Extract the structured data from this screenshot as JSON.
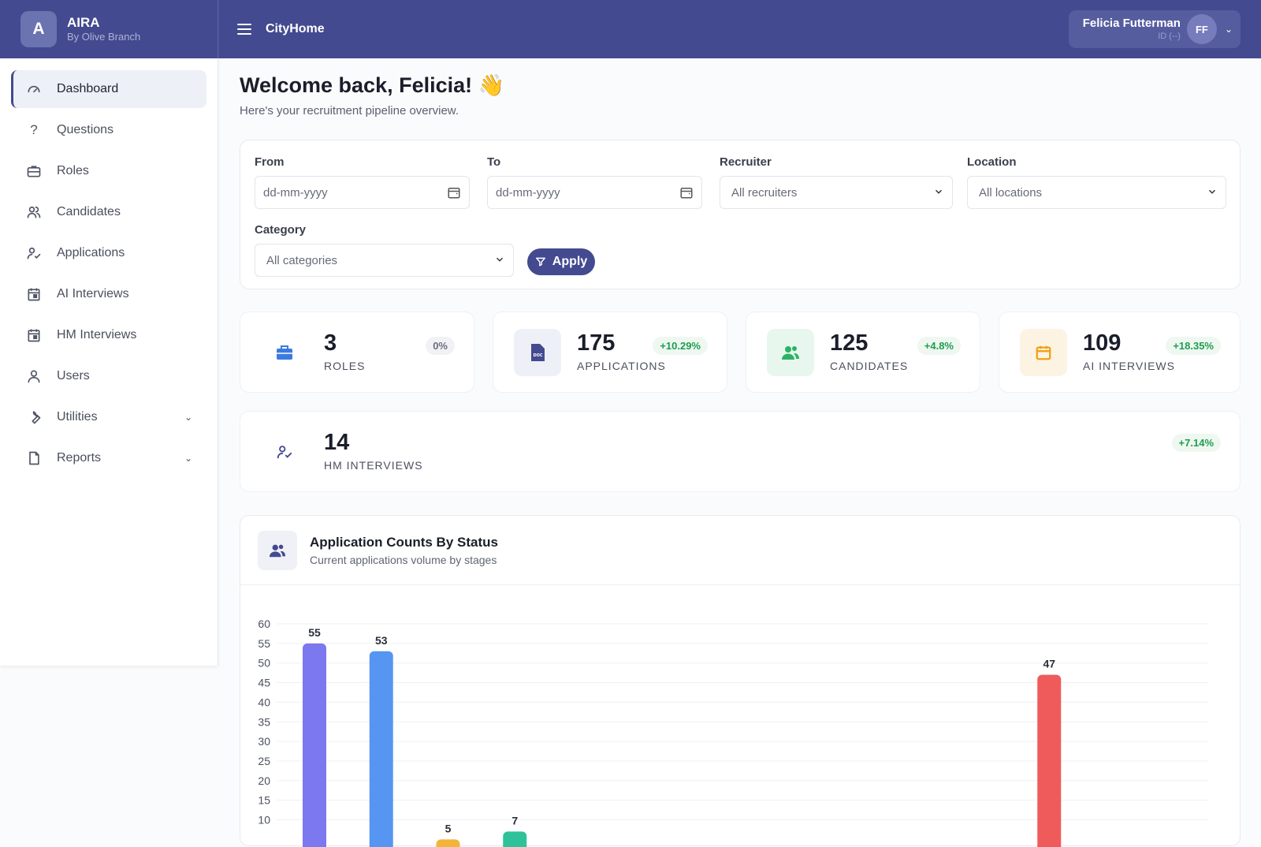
{
  "brand": {
    "logo": "A",
    "name": "AIRA",
    "sub": "By Olive Branch"
  },
  "header": {
    "app_title": "CityHome",
    "user_name": "Felicia Futterman",
    "user_id": "ID (--)",
    "avatar": "FF"
  },
  "sidebar": {
    "items": [
      {
        "label": "Dashboard",
        "icon": "gauge-icon"
      },
      {
        "label": "Questions",
        "icon": "question-icon"
      },
      {
        "label": "Roles",
        "icon": "briefcase-icon"
      },
      {
        "label": "Candidates",
        "icon": "users-icon"
      },
      {
        "label": "Applications",
        "icon": "user-check-icon"
      },
      {
        "label": "AI Interviews",
        "icon": "calendar-icon"
      },
      {
        "label": "HM Interviews",
        "icon": "calendar-icon"
      },
      {
        "label": "Users",
        "icon": "user-icon"
      },
      {
        "label": "Utilities",
        "icon": "wrench-icon"
      },
      {
        "label": "Reports",
        "icon": "file-icon"
      }
    ]
  },
  "welcome": {
    "title": "Welcome back, Felicia! 👋",
    "subtitle": "Here's your recruitment pipeline overview."
  },
  "filters": {
    "from_label": "From",
    "from_placeholder": "dd-mm-yyyy",
    "to_label": "To",
    "to_placeholder": "dd-mm-yyyy",
    "recruiter_label": "Recruiter",
    "recruiter_value": "All recruiters",
    "location_label": "Location",
    "location_value": "All locations",
    "category_label": "Category",
    "category_value": "All categories",
    "apply_label": "Apply"
  },
  "stats": [
    {
      "value": "3",
      "label": "ROLES",
      "badge": "0%",
      "badge_type": "grey",
      "color": "#3b7be0"
    },
    {
      "value": "175",
      "label": "APPLICATIONS",
      "badge": "+10.29%",
      "badge_type": "green",
      "color": "#434a8f"
    },
    {
      "value": "125",
      "label": "CANDIDATES",
      "badge": "+4.8%",
      "badge_type": "green",
      "color": "#2bb365"
    },
    {
      "value": "109",
      "label": "AI INTERVIEWS",
      "badge": "+18.35%",
      "badge_type": "green",
      "color": "#f0a019"
    },
    {
      "value": "14",
      "label": "HM INTERVIEWS",
      "badge": "+7.14%",
      "badge_type": "green",
      "color": "#434a8f"
    }
  ],
  "chart_card": {
    "title": "Application Counts By Status",
    "subtitle": "Current applications volume by stages"
  },
  "chart_data": {
    "type": "bar",
    "categories": [
      "",
      "",
      "",
      "",
      "",
      "",
      "",
      "",
      "",
      "",
      "",
      ""
    ],
    "values": [
      55,
      53,
      5,
      7,
      null,
      null,
      null,
      null,
      null,
      null,
      null,
      47
    ],
    "colors": [
      "#7b78f0",
      "#5695f2",
      "#f3b43a",
      "#2fc29a",
      null,
      null,
      null,
      null,
      null,
      null,
      null,
      "#ef5b5b"
    ],
    "yticks": [
      10,
      15,
      20,
      25,
      30,
      35,
      40,
      45,
      50,
      55,
      60
    ],
    "ylim": [
      0,
      60
    ]
  }
}
